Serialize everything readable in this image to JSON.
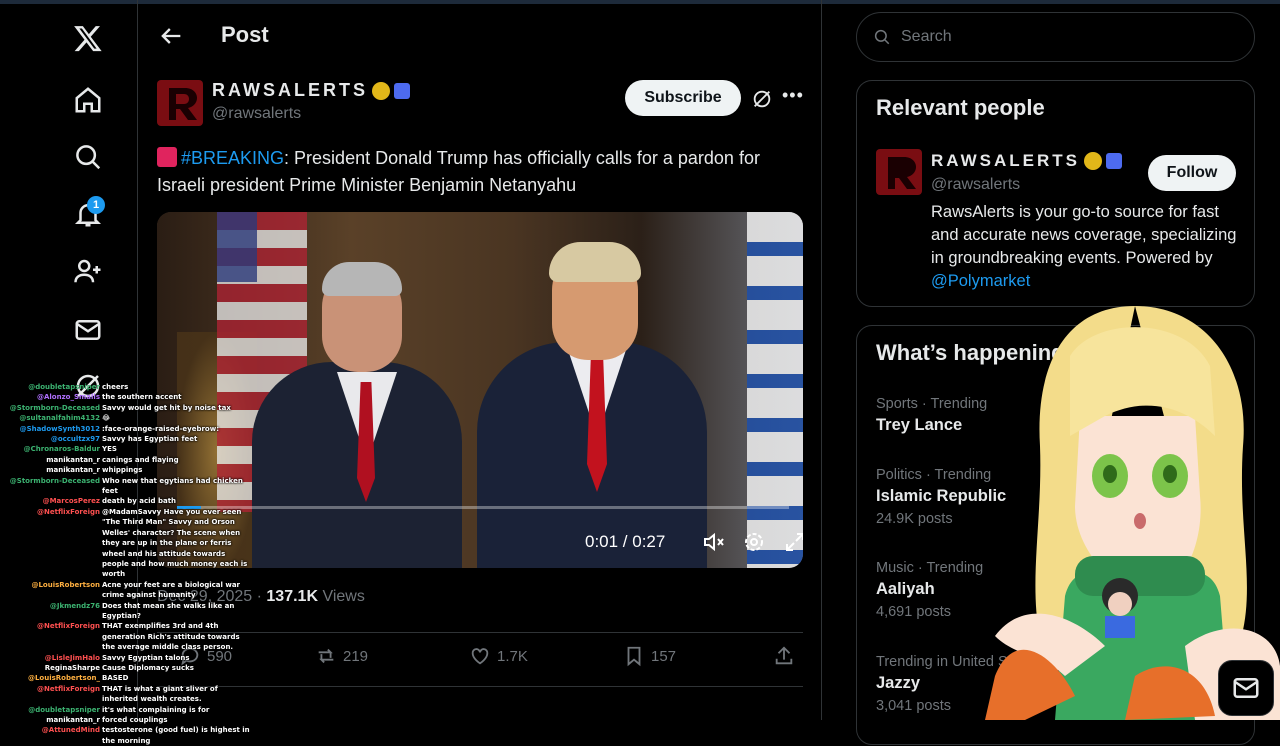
{
  "header": {
    "title": "Post"
  },
  "nav": {
    "notifications_count": "1"
  },
  "post": {
    "author_name": "RAWSALERTS",
    "author_handle": "@rawsalerts",
    "subscribe_label": "Subscribe",
    "text_hashtag": "#BREAKING",
    "text_body": ": President Donald Trump has officially calls for a pardon for Israeli president Prime Minister Benjamin Netanyahu",
    "video": {
      "time": "0:01 / 0:27",
      "progress": 0.04
    },
    "date": "Dec 29, 2025",
    "views_count": "137.1K",
    "views_label": "Views",
    "replies": "590",
    "reposts": "219",
    "likes": "1.7K",
    "bookmarks": "157"
  },
  "search": {
    "placeholder": "Search"
  },
  "relevant_people": {
    "title": "Relevant people",
    "name": "RAWSALERTS",
    "handle": "@rawsalerts",
    "follow_label": "Follow",
    "bio": "RawsAlerts is your go-to source for fast and accurate news coverage, specializing in groundbreaking events. Powered by ",
    "bio_mention": "@Polymarket"
  },
  "whats_happening": {
    "title": "What’s happening",
    "trends": [
      {
        "category": "Sports · Trending",
        "name": "Trey Lance",
        "posts": ""
      },
      {
        "category": "Politics · Trending",
        "name": "Islamic Republic",
        "posts": "24.9K posts"
      },
      {
        "category": "Music · Trending",
        "name": "Aaliyah",
        "posts": "4,691 posts"
      },
      {
        "category": "Trending in United States",
        "name": "Jazzy",
        "posts": "3,041 posts"
      }
    ]
  },
  "chat": [
    {
      "user": "@doubletapsniper",
      "msg": "cheers",
      "color": "#3cb371"
    },
    {
      "user": "@Alonzo_Smalls",
      "msg": "the southern accent",
      "color": "#b070ff"
    },
    {
      "user": "@Stormborn-Deceased",
      "msg": "Savvy would get hit by noise tax",
      "color": "#3cb371"
    },
    {
      "user": "@sultanalfahim4132",
      "msg": "😂",
      "color": "#3cb371"
    },
    {
      "user": "@ShadowSynth3012",
      "msg": ":face-orange-raised-eyebrow:",
      "color": "#1d9bf0"
    },
    {
      "user": "@occultzx97",
      "msg": "Savvy has Egyptian feet",
      "color": "#1d9bf0"
    },
    {
      "user": "@Chronaros-Baldur",
      "msg": "YES",
      "color": "#3cb371"
    },
    {
      "user": "manikantan_r",
      "msg": "canings and flaying",
      "color": "#ffffff"
    },
    {
      "user": "manikantan_r",
      "msg": "whippings",
      "color": "#ffffff"
    },
    {
      "user": "@Stormborn-Deceased",
      "msg": "Who new that egytians had chicken feet",
      "color": "#3cb371"
    },
    {
      "user": "@MarcosPerez",
      "msg": "death by acid bath",
      "color": "#ff5050"
    },
    {
      "user": "@NetflixForeign",
      "msg": "@MadamSavvy Have you ever seen \"The Third Man\" Savvy and Orson Welles' character? The scene when they are up in the plane or ferris wheel and his attitude towards people and how much money each is worth",
      "color": "#ff5050"
    },
    {
      "user": "@LouisRobertson",
      "msg": "Acne your feet are a biological war crime against humanity",
      "color": "#ffb040"
    },
    {
      "user": "@Jkmendz76",
      "msg": "Does that mean she walks like an Egyptian?",
      "color": "#3cb371"
    },
    {
      "user": "@NetflixForeign",
      "msg": "THAT exemplifies 3rd and 4th generation Rich's attitude towards the average middle class person.",
      "color": "#ff5050"
    },
    {
      "user": "@LisleJimHalo",
      "msg": "Savvy Egyptian talons",
      "color": "#ff5050"
    },
    {
      "user": "ReginaSharpe",
      "msg": "Cause Diplomacy sucks",
      "color": "#ffffff"
    },
    {
      "user": "@LouisRobertson_",
      "msg": "BASED",
      "color": "#ffb040"
    },
    {
      "user": "@NetflixForeign",
      "msg": "THAT is what a giant sliver of inherited wealth creates.",
      "color": "#ff5050"
    },
    {
      "user": "@doubletapsniper",
      "msg": "it's what complaining is for",
      "color": "#3cb371"
    },
    {
      "user": "manikantan_r",
      "msg": "forced couplings",
      "color": "#ffffff"
    },
    {
      "user": "@AttunedMind",
      "msg": "testosterone (good fuel) is highest in the morning",
      "color": "#ff5050"
    }
  ]
}
